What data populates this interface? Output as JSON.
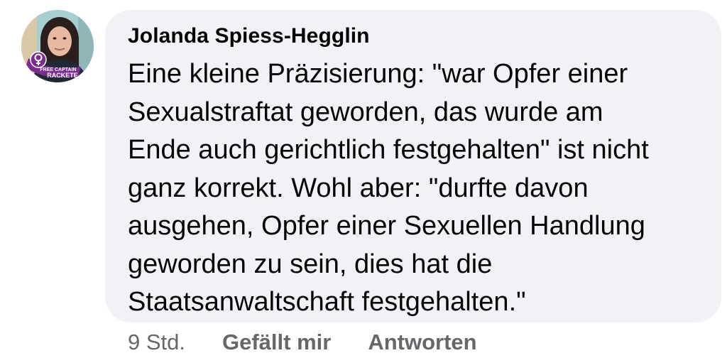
{
  "comment": {
    "author": "Jolanda Spiess-Hegglin",
    "avatar": {
      "badge_line1": "FREE CAPTAIN",
      "badge_line2": "RACKETE",
      "badge_color": "#7b2d8e"
    },
    "text_lines": [
      "Eine kleine Präzisierung: \"war Opfer einer",
      "Sexualstraftat geworden, das wurde am",
      "Ende auch gerichtlich festgehalten\" ist nicht",
      "ganz korrekt. Wohl aber: \"durfte davon",
      "ausgehen, Opfer einer Sexuellen Handlung",
      "geworden zu sein, dies hat die",
      "Staatsanwaltschaft festgehalten.\""
    ],
    "timestamp": "9 Std.",
    "like_label": "Gefällt mir",
    "reply_label": "Antworten"
  },
  "colors": {
    "bubble_bg": "#f0f2f5",
    "text": "#050505",
    "meta_text": "#65676b"
  }
}
